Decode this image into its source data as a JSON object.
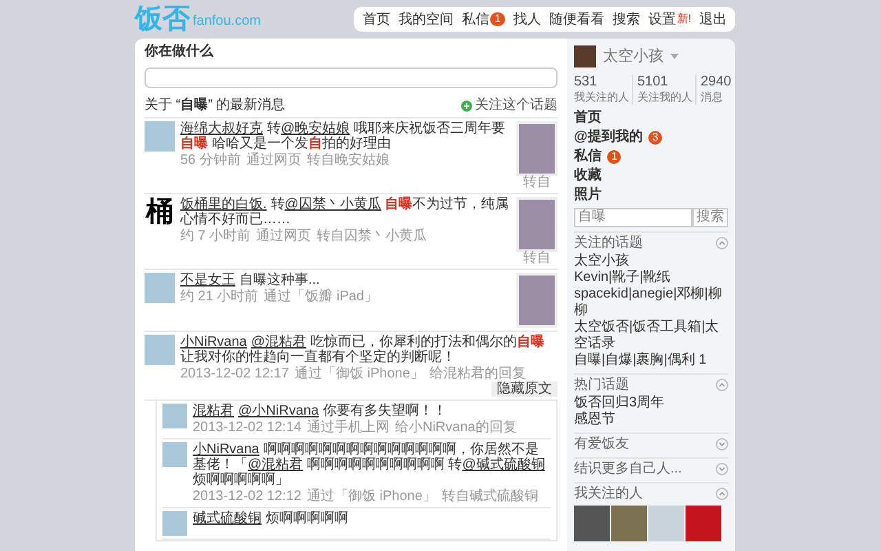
{
  "logo": {
    "name": "饭否",
    "domain": "fanfou.com"
  },
  "nav": [
    {
      "label": "首页"
    },
    {
      "label": "我的空间"
    },
    {
      "label": "私信",
      "badge": "1"
    },
    {
      "label": "找人"
    },
    {
      "label": "随便看看"
    },
    {
      "label": "搜索"
    },
    {
      "label": "设置",
      "tag": "新!"
    },
    {
      "label": "退出"
    }
  ],
  "composer": {
    "title": "你在做什么"
  },
  "topic": {
    "title": "关于 “**自曝**” 的最新消息",
    "follow": "关注这个话题"
  },
  "statuses": [
    {
      "author": "海绵大叔好克",
      "parts": [
        {
          "kind": "plain",
          "text": "转"
        },
        {
          "kind": "link",
          "text": "@晚安姑娘"
        },
        {
          "kind": "plain",
          "text": " 哦耶来庆祝饭否三周年要"
        },
        {
          "kind": "highlight",
          "text": "自曝"
        },
        {
          "kind": "plain",
          "text": " 哈哈又是一个发"
        },
        {
          "kind": "highlight",
          "text": "自"
        },
        {
          "kind": "plain",
          "text": "拍的好理由"
        }
      ],
      "meta": [
        "56 分钟前",
        "通过网页",
        "转自晚安姑娘"
      ],
      "photo": true,
      "photo_caption": "转自"
    },
    {
      "author": "饭桶里的白饭.",
      "avatar_text": "桶",
      "parts": [
        {
          "kind": "plain",
          "text": "转"
        },
        {
          "kind": "link",
          "text": "@囚禁丶小黄瓜"
        },
        {
          "kind": "highlight",
          "text": " 自曝"
        },
        {
          "kind": "plain",
          "text": "不为过节，纯属心情不好而已……"
        }
      ],
      "meta": [
        "约 7 小时前",
        "通过网页",
        "转自囚禁丶小黄瓜"
      ],
      "photo": true,
      "photo_caption": "转自"
    },
    {
      "author": "不是女王",
      "parts": [
        {
          "kind": "plain",
          "text": "自曝这种事..."
        }
      ],
      "meta": [
        "约 21 小时前",
        "通过「饭瓣 iPad」"
      ],
      "photo": true
    },
    {
      "author": "小NiRvana",
      "parts": [
        {
          "kind": "link",
          "text": "@混粘君"
        },
        {
          "kind": "plain",
          "text": " 吃惊而已，你犀利的打法和偶尔的"
        },
        {
          "kind": "highlight",
          "text": "自曝"
        },
        {
          "kind": "plain",
          "text": "让我对你的性趋向一直都有个坚定的判断呢！"
        }
      ],
      "meta": [
        "2013-12-02 12:17",
        "通过「御饭 iPhone」",
        "给混粘君的回复"
      ],
      "photo": false,
      "toggle": "隐藏原文",
      "replies": [
        {
          "author": "混粘君",
          "parts": [
            {
              "kind": "link",
              "text": "@小NiRvana"
            },
            {
              "kind": "plain",
              "text": " 你要有多失望啊！！"
            }
          ],
          "meta": [
            "2013-12-02 12:14",
            "通过手机上网",
            "给小NiRvana的回复"
          ]
        },
        {
          "author": "小NiRvana",
          "parts": [
            {
              "kind": "plain",
              "text": "啊啊啊啊啊啊啊啊啊啊啊啊啊啊，你居然不是基佬！「"
            },
            {
              "kind": "link",
              "text": "@混粘君"
            },
            {
              "kind": "plain",
              "text": " 啊啊啊啊啊啊啊啊啊啊 转"
            },
            {
              "kind": "link",
              "text": "@碱式硫酸铜"
            },
            {
              "kind": "plain",
              "text": " 烦啊啊啊啊啊」"
            }
          ],
          "meta": [
            "2013-12-02 12:12",
            "通过「御饭 iPhone」",
            "转自碱式硫酸铜"
          ]
        },
        {
          "author": "碱式硫酸铜",
          "parts": [
            {
              "kind": "plain",
              "text": "烦啊啊啊啊啊"
            }
          ]
        }
      ]
    }
  ],
  "sidebar": {
    "user": {
      "name": "太空小孩"
    },
    "stats": [
      {
        "value": "531",
        "label": "我关注的人"
      },
      {
        "value": "5101",
        "label": "关注我的人"
      },
      {
        "value": "2940",
        "label": "消息"
      }
    ],
    "menu": [
      {
        "label": "首页"
      },
      {
        "label": "@提到我的",
        "badge": "3"
      },
      {
        "label": "私信",
        "badge": "1"
      },
      {
        "label": "收藏"
      },
      {
        "label": "照片"
      }
    ],
    "search": {
      "placeholder": "自曝",
      "button": "搜索"
    },
    "sections": [
      {
        "title": "关注的话题",
        "expanded": true,
        "items": [
          "太空小孩",
          "Kevin|靴子|靴纸",
          "spacekid|anegie|邓柳|柳柳",
          "太空饭否|饭否工具箱|太空话录",
          "自曝|自爆|裹胸|偶利 1"
        ]
      },
      {
        "title": "热门话题",
        "expanded": true,
        "items": [
          "饭否回归3周年",
          "感恩节"
        ]
      },
      {
        "title": "有爱饭友",
        "expanded": false
      },
      {
        "title": "结识更多自己人...",
        "expanded": false
      },
      {
        "title": "我关注的人",
        "expanded": true
      }
    ]
  }
}
